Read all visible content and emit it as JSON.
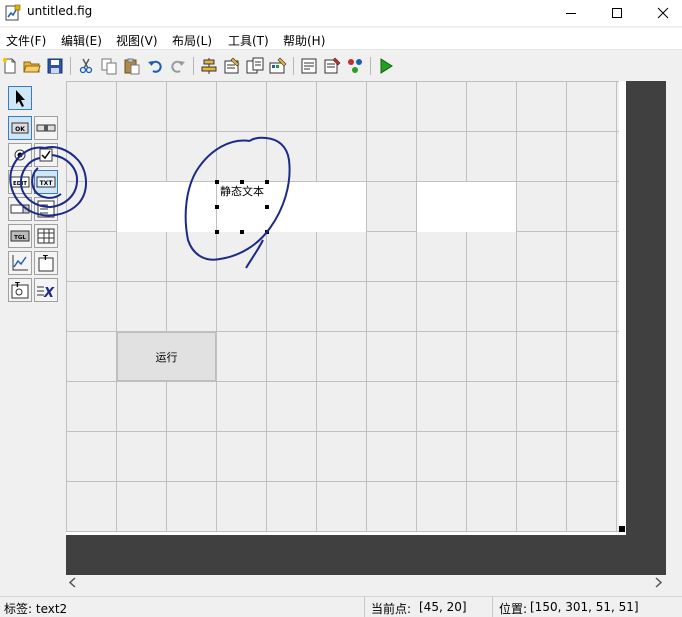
{
  "window": {
    "title": "untitled.fig"
  },
  "menu": [
    "文件(F)",
    "编辑(E)",
    "视图(V)",
    "布局(L)",
    "工具(T)",
    "帮助(H)"
  ],
  "toolbar": {
    "icons": [
      "new-file-icon",
      "open-folder-icon",
      "save-icon",
      "cut-icon",
      "copy-icon",
      "paste-icon",
      "undo-icon",
      "redo-icon",
      "align-icon",
      "menu-editor-icon",
      "tab-order-icon",
      "toolbar-editor-icon",
      "editor-icon",
      "property-inspector-icon",
      "object-browser-icon",
      "run-icon"
    ]
  },
  "palette": {
    "tools": [
      {
        "name": "select-tool",
        "label": ""
      },
      {
        "name": "push-button-tool",
        "label": "OK"
      },
      {
        "name": "slider-tool",
        "label": ""
      },
      {
        "name": "radio-button-tool",
        "label": ""
      },
      {
        "name": "checkbox-tool",
        "label": ""
      },
      {
        "name": "edit-text-tool",
        "label": "EDIT"
      },
      {
        "name": "static-text-tool",
        "label": "TXT"
      },
      {
        "name": "popup-menu-tool",
        "label": ""
      },
      {
        "name": "listbox-tool",
        "label": ""
      },
      {
        "name": "toggle-button-tool",
        "label": "TGL"
      },
      {
        "name": "table-tool",
        "label": ""
      },
      {
        "name": "axes-tool",
        "label": ""
      },
      {
        "name": "panel-tool",
        "label": "T"
      },
      {
        "name": "button-group-tool",
        "label": "T"
      },
      {
        "name": "activex-tool",
        "label": "X"
      }
    ]
  },
  "canvas": {
    "selected_text": "静态文本",
    "button_label": "运行"
  },
  "colors": {
    "canvas_background": "#efefef",
    "outer_background": "#404040",
    "selection_highlight": "#cfe6f7",
    "annotation_ink": "#1c2a8a",
    "run_green": "#22a022"
  },
  "status": {
    "tag": "标签: text2",
    "current_point_label": "当前点:",
    "current_point_value": "[45, 20]",
    "position_label": "位置:",
    "position_value": "[150, 301, 51, 51]"
  }
}
